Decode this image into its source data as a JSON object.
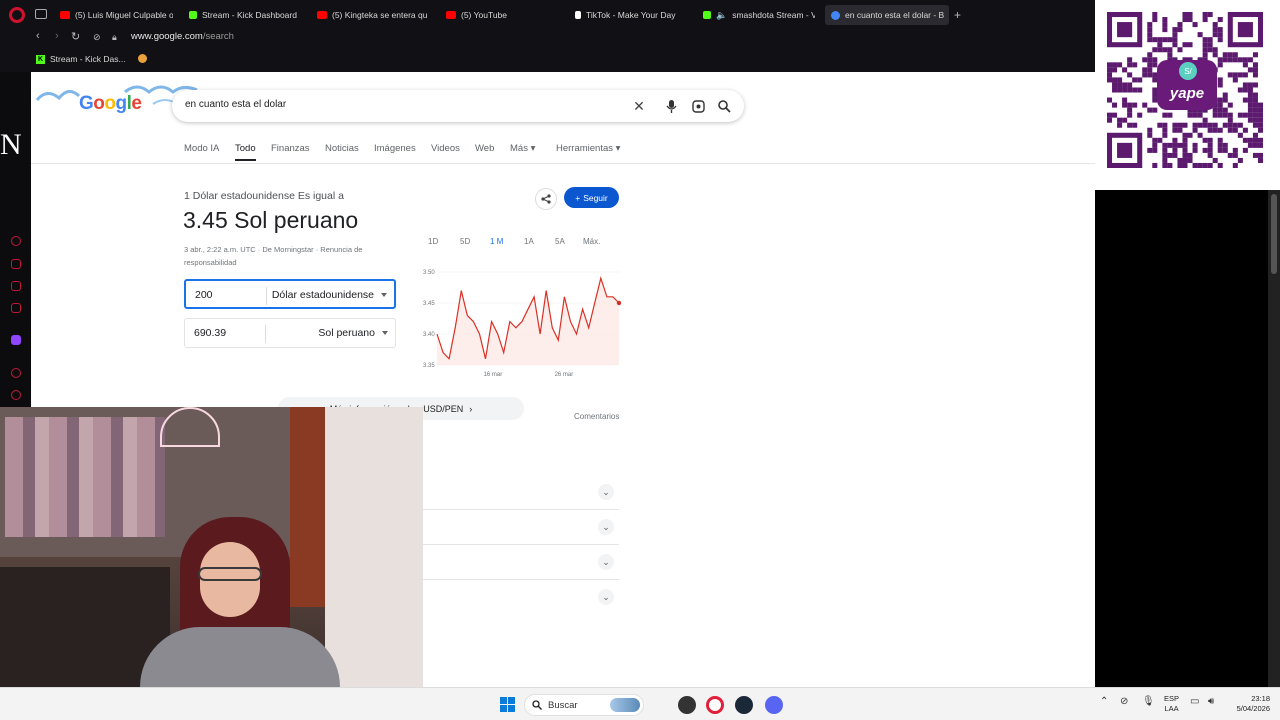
{
  "browser": {
    "tabs": [
      {
        "label": "(5) Luis Miguel Culpable o",
        "color": "#ff0000"
      },
      {
        "label": "Stream - Kick Dashboard",
        "color": "#53fc18"
      },
      {
        "label": "(5) Kingteka se entera qu",
        "color": "#ff0000"
      },
      {
        "label": "(5) YouTube",
        "color": "#ff0000"
      },
      {
        "label": "TikTok - Make Your Day",
        "color": "#ffffff"
      },
      {
        "label": "smashdota Stream - V",
        "color": "#53fc18"
      },
      {
        "label": "en cuanto esta el dolar - B",
        "color": "#4285f4"
      }
    ],
    "new_tab": "+",
    "url_host": "www.google.com",
    "url_path": "/search",
    "bookmark": "Stream - Kick Das..."
  },
  "sidebar": {
    "letter": "N"
  },
  "google": {
    "logo": [
      "G",
      "o",
      "o",
      "g",
      "l",
      "e"
    ],
    "query": "en cuanto esta el dolar",
    "nav": [
      "Modo IA",
      "Todo",
      "Finanzas",
      "Noticias",
      "Imágenes",
      "Videos",
      "Web",
      "Más ▾",
      "Herramientas ▾"
    ],
    "conversion_label": "1 Dólar estadounidense Es igual a",
    "rate": "3.45 Sol peruano",
    "meta": "3 abr., 2:22 a.m. UTC · De Morningstar · Renuncia de responsabilidad",
    "follow": "Seguir",
    "input_amount": "200",
    "input_currency": "Dólar estadounidense",
    "output_amount": "690.39",
    "output_currency": "Sol peruano",
    "ranges": [
      "1D",
      "5D",
      "1 M",
      "1A",
      "5A",
      "Máx."
    ],
    "active_range": "1 M",
    "more_info": "Más información sobre USD/PEN",
    "comments": "Comentarios"
  },
  "chart_data": {
    "type": "line",
    "title": "",
    "xlabel": "",
    "ylabel": "",
    "y_ticks": [
      "3.50",
      "3.45",
      "3.40",
      "3.35"
    ],
    "ylim": [
      3.35,
      3.5
    ],
    "x_ticks": [
      "16 mar",
      "26 mar"
    ],
    "series": [
      {
        "color": "#d93025",
        "values": [
          3.4,
          3.37,
          3.36,
          3.41,
          3.47,
          3.43,
          3.42,
          3.4,
          3.36,
          3.42,
          3.4,
          3.37,
          3.42,
          3.41,
          3.42,
          3.44,
          3.46,
          3.4,
          3.47,
          3.41,
          3.39,
          3.46,
          3.42,
          3.4,
          3.44,
          3.41,
          3.45,
          3.49,
          3.46,
          3.46,
          3.45
        ]
      }
    ]
  },
  "qr": {
    "brand": "yape",
    "badge": "S/"
  },
  "taskbar": {
    "search": "Buscar",
    "lang_1": "ESP",
    "lang_2": "LAA",
    "time": "23:18",
    "date": "5/04/2026"
  }
}
